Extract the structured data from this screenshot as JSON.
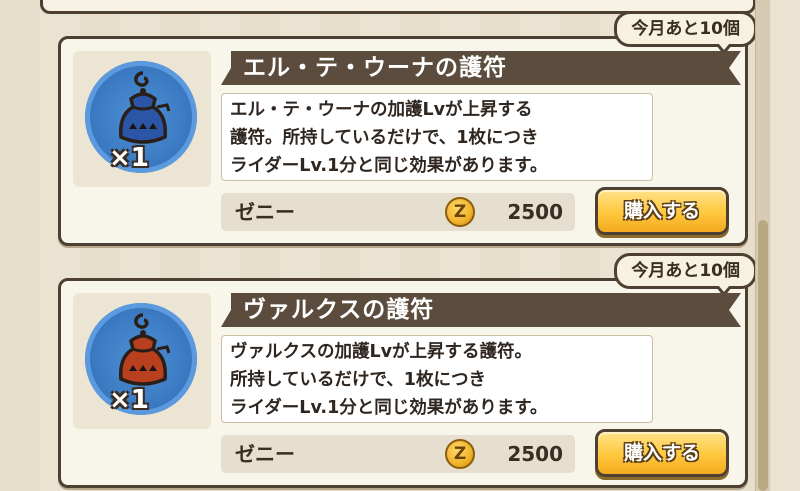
{
  "colors": {
    "charm_blue": "#3c7cc4",
    "ribbon": "#5b4c3d",
    "buy_button": "#ffc83e",
    "frame": "#4d3f31"
  },
  "items": [
    {
      "badge": "今月あと10個",
      "title": "エル・テ・ウーナの護符",
      "desc_lines": [
        "エル・テ・ウーナの加護Lvが上昇する",
        "護符。所持しているだけで、1枚につき",
        "ライダーLv.1分と同じ効果があります。"
      ],
      "quantity": "×1",
      "currency_label": "ゼニー",
      "currency_icon": "zeny-coin-icon",
      "currency_symbol": "Z",
      "price": "2500",
      "buy_label": "購入する",
      "charm_color": "#2b56a8",
      "charm_icon": "blue-charm-icon"
    },
    {
      "badge": "今月あと10個",
      "title": "ヴァルクスの護符",
      "desc_lines": [
        "ヴァルクスの加護Lvが上昇する護符。",
        "所持しているだけで、1枚につき",
        "ライダーLv.1分と同じ効果があります。"
      ],
      "quantity": "×1",
      "currency_label": "ゼニー",
      "currency_icon": "zeny-coin-icon",
      "currency_symbol": "Z",
      "price": "2500",
      "buy_label": "購入する",
      "charm_color": "#b8401f",
      "charm_icon": "red-charm-icon"
    }
  ]
}
